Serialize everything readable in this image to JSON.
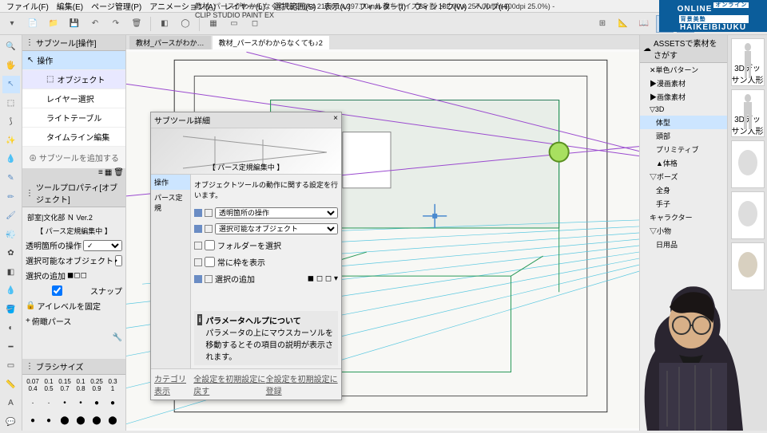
{
  "app": {
    "title": "教材_パースがわからなくても♪2* (A4 210.00 x 297.00mm 裁ちサイズB5 判 182.00 x 257.00mm 600dpi 25.0%) - CLIP STUDIO PAINT EX"
  },
  "menu": {
    "file": "ファイル(F)",
    "edit": "編集(E)",
    "page": "ページ管理(P)",
    "anim": "アニメーション(A)",
    "layer": "レイヤー(L)",
    "select": "選択範囲(S)",
    "view": "表示(V)",
    "filter": "フィルター(I)",
    "window": "ウィンドウ(W)",
    "help": "ヘルプ(H)"
  },
  "subtool": {
    "header": "サブツール[操作]",
    "items": [
      {
        "label": "操作",
        "selected": true,
        "icon": "move"
      },
      {
        "label": "オブジェクト",
        "active": true,
        "icon": "cursor"
      },
      {
        "label": "レイヤー選択",
        "icon": "layer"
      },
      {
        "label": "ライトテーブル",
        "icon": "light"
      },
      {
        "label": "タイムライン編集",
        "icon": "timeline"
      }
    ],
    "add": "サブツールを追加する"
  },
  "toolprop": {
    "header": "ツールプロパティ[オブジェクト]",
    "title": "部室|文化部 Ｎ Ver.2",
    "editing_label": "【 パース定規編集中 】",
    "rows": {
      "transparent_op": "透明箇所の操作",
      "selectable_obj": "選択可能なオブジェクト",
      "add_selection_label": "選択の追加",
      "snap_label": "スナップ",
      "eye_level_label": "アイレベルを固定",
      "mirror_label": "俯瞰パース"
    }
  },
  "brush": {
    "header": "ブラシサイズ",
    "sizes": [
      "0.07",
      "0.1",
      "0.15",
      "0.1",
      "0.25",
      "0.3"
    ],
    "sizes2": [
      "0.4",
      "0.5",
      "0.7",
      "0.8",
      "0.9",
      "1"
    ]
  },
  "canvas": {
    "tab1": "教材_パースがわか…",
    "tab2": "教材_パースがわからなくても♪2"
  },
  "right": {
    "header": "ASSETSで素材をさがす",
    "tree": [
      {
        "label": "✕単色パターン",
        "exp": true
      },
      {
        "label": "▶漫画素材"
      },
      {
        "label": "▶画像素材"
      },
      {
        "label": "▽3D",
        "exp": true
      },
      {
        "label": "体型",
        "indent": 1,
        "selected": true
      },
      {
        "label": "頭部",
        "indent": 1
      },
      {
        "label": "プリミティブ",
        "indent": 1
      },
      {
        "label": "▲体格",
        "indent": 1
      },
      {
        "label": "▽ポーズ",
        "exp": true
      },
      {
        "label": "全身",
        "indent": 1
      },
      {
        "label": "手子",
        "indent": 1
      },
      {
        "label": "キャラクター"
      },
      {
        "label": "▽小物",
        "exp": true
      },
      {
        "label": "日用品",
        "indent": 1
      }
    ]
  },
  "thumbs": [
    {
      "label": "3Dデッサン人形"
    },
    {
      "label": "3Dデッサン人形"
    },
    {
      "label": ""
    },
    {
      "label": ""
    },
    {
      "label": ""
    }
  ],
  "dialog": {
    "title": "サブツール詳細",
    "close": "×",
    "preview_label": "【 パース定規編集中 】",
    "side": [
      "操作",
      "パース定規"
    ],
    "desc": "オブジェクトツールの動作に関する設定を行います。",
    "rows": {
      "transparent_op": "透明箇所の操作",
      "selectable_obj": "選択可能なオブジェクト",
      "select_folder": "フォルダーを選択",
      "always_show": "常に枠を表示",
      "add_selection": "選択の追加"
    },
    "help_title": "パラメータヘルプについて",
    "help_text": "パラメータの上にマウスカーソルを移動するとその項目の説明が表示されます。",
    "category": "カテゴリ表示",
    "footer1": "全設定を初期設定に戻す",
    "footer2": "全設定を初期設定に登録"
  },
  "online": {
    "l1": "ONLINE",
    "l1b": "オンライン",
    "l1c": "背景美塾",
    "l2": "HAIKEIBIJUKU"
  }
}
